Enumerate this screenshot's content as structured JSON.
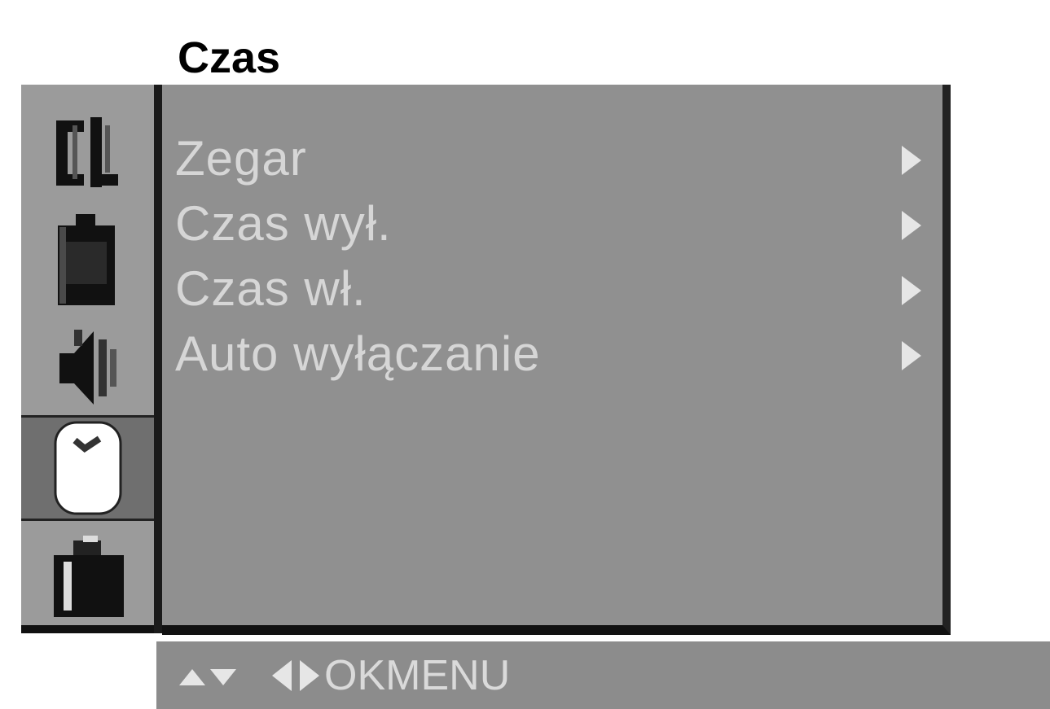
{
  "title": "Czas",
  "sidebar": {
    "items": [
      {
        "icon": "channel-icon",
        "active": false
      },
      {
        "icon": "picture-icon",
        "active": false
      },
      {
        "icon": "sound-icon",
        "active": false
      },
      {
        "icon": "clock-icon",
        "active": true
      },
      {
        "icon": "options-icon",
        "active": false
      }
    ]
  },
  "menu": {
    "items": [
      {
        "label": "Zegar"
      },
      {
        "label": "Czas  wył."
      },
      {
        "label": "Czas  wł."
      },
      {
        "label": "Auto  wyłączanie"
      }
    ]
  },
  "bottom_bar": {
    "ok_label": "OK",
    "menu_label": "MENU"
  }
}
